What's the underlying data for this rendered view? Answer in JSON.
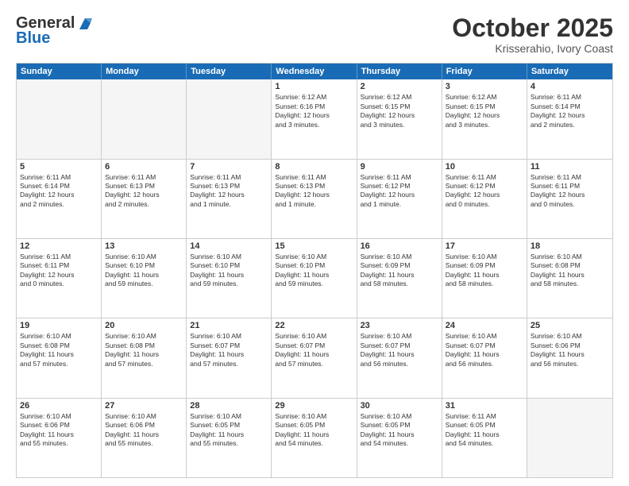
{
  "header": {
    "logo_general": "General",
    "logo_blue": "Blue",
    "month": "October 2025",
    "location": "Krisserahio, Ivory Coast"
  },
  "dayHeaders": [
    "Sunday",
    "Monday",
    "Tuesday",
    "Wednesday",
    "Thursday",
    "Friday",
    "Saturday"
  ],
  "weeks": [
    [
      {
        "day": "",
        "info": ""
      },
      {
        "day": "",
        "info": ""
      },
      {
        "day": "",
        "info": ""
      },
      {
        "day": "1",
        "info": "Sunrise: 6:12 AM\nSunset: 6:16 PM\nDaylight: 12 hours\nand 3 minutes."
      },
      {
        "day": "2",
        "info": "Sunrise: 6:12 AM\nSunset: 6:15 PM\nDaylight: 12 hours\nand 3 minutes."
      },
      {
        "day": "3",
        "info": "Sunrise: 6:12 AM\nSunset: 6:15 PM\nDaylight: 12 hours\nand 3 minutes."
      },
      {
        "day": "4",
        "info": "Sunrise: 6:11 AM\nSunset: 6:14 PM\nDaylight: 12 hours\nand 2 minutes."
      }
    ],
    [
      {
        "day": "5",
        "info": "Sunrise: 6:11 AM\nSunset: 6:14 PM\nDaylight: 12 hours\nand 2 minutes."
      },
      {
        "day": "6",
        "info": "Sunrise: 6:11 AM\nSunset: 6:13 PM\nDaylight: 12 hours\nand 2 minutes."
      },
      {
        "day": "7",
        "info": "Sunrise: 6:11 AM\nSunset: 6:13 PM\nDaylight: 12 hours\nand 1 minute."
      },
      {
        "day": "8",
        "info": "Sunrise: 6:11 AM\nSunset: 6:13 PM\nDaylight: 12 hours\nand 1 minute."
      },
      {
        "day": "9",
        "info": "Sunrise: 6:11 AM\nSunset: 6:12 PM\nDaylight: 12 hours\nand 1 minute."
      },
      {
        "day": "10",
        "info": "Sunrise: 6:11 AM\nSunset: 6:12 PM\nDaylight: 12 hours\nand 0 minutes."
      },
      {
        "day": "11",
        "info": "Sunrise: 6:11 AM\nSunset: 6:11 PM\nDaylight: 12 hours\nand 0 minutes."
      }
    ],
    [
      {
        "day": "12",
        "info": "Sunrise: 6:11 AM\nSunset: 6:11 PM\nDaylight: 12 hours\nand 0 minutes."
      },
      {
        "day": "13",
        "info": "Sunrise: 6:10 AM\nSunset: 6:10 PM\nDaylight: 11 hours\nand 59 minutes."
      },
      {
        "day": "14",
        "info": "Sunrise: 6:10 AM\nSunset: 6:10 PM\nDaylight: 11 hours\nand 59 minutes."
      },
      {
        "day": "15",
        "info": "Sunrise: 6:10 AM\nSunset: 6:10 PM\nDaylight: 11 hours\nand 59 minutes."
      },
      {
        "day": "16",
        "info": "Sunrise: 6:10 AM\nSunset: 6:09 PM\nDaylight: 11 hours\nand 58 minutes."
      },
      {
        "day": "17",
        "info": "Sunrise: 6:10 AM\nSunset: 6:09 PM\nDaylight: 11 hours\nand 58 minutes."
      },
      {
        "day": "18",
        "info": "Sunrise: 6:10 AM\nSunset: 6:08 PM\nDaylight: 11 hours\nand 58 minutes."
      }
    ],
    [
      {
        "day": "19",
        "info": "Sunrise: 6:10 AM\nSunset: 6:08 PM\nDaylight: 11 hours\nand 57 minutes."
      },
      {
        "day": "20",
        "info": "Sunrise: 6:10 AM\nSunset: 6:08 PM\nDaylight: 11 hours\nand 57 minutes."
      },
      {
        "day": "21",
        "info": "Sunrise: 6:10 AM\nSunset: 6:07 PM\nDaylight: 11 hours\nand 57 minutes."
      },
      {
        "day": "22",
        "info": "Sunrise: 6:10 AM\nSunset: 6:07 PM\nDaylight: 11 hours\nand 57 minutes."
      },
      {
        "day": "23",
        "info": "Sunrise: 6:10 AM\nSunset: 6:07 PM\nDaylight: 11 hours\nand 56 minutes."
      },
      {
        "day": "24",
        "info": "Sunrise: 6:10 AM\nSunset: 6:07 PM\nDaylight: 11 hours\nand 56 minutes."
      },
      {
        "day": "25",
        "info": "Sunrise: 6:10 AM\nSunset: 6:06 PM\nDaylight: 11 hours\nand 56 minutes."
      }
    ],
    [
      {
        "day": "26",
        "info": "Sunrise: 6:10 AM\nSunset: 6:06 PM\nDaylight: 11 hours\nand 55 minutes."
      },
      {
        "day": "27",
        "info": "Sunrise: 6:10 AM\nSunset: 6:06 PM\nDaylight: 11 hours\nand 55 minutes."
      },
      {
        "day": "28",
        "info": "Sunrise: 6:10 AM\nSunset: 6:05 PM\nDaylight: 11 hours\nand 55 minutes."
      },
      {
        "day": "29",
        "info": "Sunrise: 6:10 AM\nSunset: 6:05 PM\nDaylight: 11 hours\nand 54 minutes."
      },
      {
        "day": "30",
        "info": "Sunrise: 6:10 AM\nSunset: 6:05 PM\nDaylight: 11 hours\nand 54 minutes."
      },
      {
        "day": "31",
        "info": "Sunrise: 6:11 AM\nSunset: 6:05 PM\nDaylight: 11 hours\nand 54 minutes."
      },
      {
        "day": "",
        "info": ""
      }
    ]
  ]
}
